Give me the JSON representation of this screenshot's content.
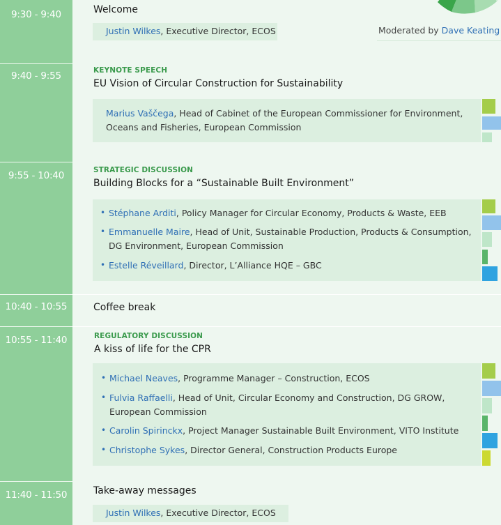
{
  "sessions": [
    {
      "time": "9:30 - 9:40",
      "title": "Welcome"
    },
    {
      "time": "9:40 - 9:55",
      "eyebrow": "KEYNOTE SPEECH",
      "title": "EU Vision of Circular Construction for Sustainability"
    },
    {
      "time": "9:55 - 10:40",
      "eyebrow": "STRATEGIC DISCUSSION",
      "title": "Building Blocks for a “Sustainable Built Environment”"
    },
    {
      "time": "10:40 - 10:55",
      "title": "Coffee break"
    },
    {
      "time": "10:55 - 11:40",
      "eyebrow": "REGULATORY DISCUSSION",
      "title": "A kiss of life for the CPR"
    },
    {
      "time": "11:40 - 11:50",
      "title": "Take-away messages"
    }
  ],
  "moderator": {
    "prefix": "Moderated by ",
    "name": "Dave Keating"
  },
  "welcome_speaker": {
    "name": "Justin Wilkes",
    "role": ", Executive Director, ECOS"
  },
  "keynote_speaker": {
    "name": "Marius Vaščega",
    "role_line1": ", Head of Cabinet of the European Commissioner for Environment,",
    "role_line2": "Oceans and Fisheries, European Commission"
  },
  "strategic_speakers": [
    {
      "name": "Stéphane Arditi",
      "role": ", Policy Manager for Circular Economy, Products & Waste, EEB"
    },
    {
      "name": "Emmanuelle Maire",
      "role": ", Head of Unit, Sustainable Production, Products & Consumption,",
      "role_line2": "DG Environment, European Commission"
    },
    {
      "name": "Estelle Réveillard",
      "role": ", Director, L’Alliance HQE – GBC"
    }
  ],
  "regulatory_speakers": [
    {
      "name": "Michael Neaves",
      "role": ", Programme Manager – Construction, ECOS"
    },
    {
      "name": "Fulvia Raffaelli",
      "role": ", Head of Unit, Circular Economy and Construction, DG GROW,",
      "role_line2": "European Commission"
    },
    {
      "name": "Carolin Spirinckx",
      "role": ", Project Manager Sustainable Built Environment, VITO Institute"
    },
    {
      "name": "Christophe Sykes",
      "role": ", Director General, Construction Products Europe"
    }
  ],
  "closing_speaker": {
    "name": "Justin Wilkes",
    "role": ", Executive Director, ECOS"
  },
  "bullet": "•",
  "colors": {
    "time_column": "#8fcf9a",
    "speaker_name": "#2f6fb5",
    "eyebrow": "#3a9a4c",
    "box": "#dcefe0",
    "page": "#eef7f0"
  }
}
